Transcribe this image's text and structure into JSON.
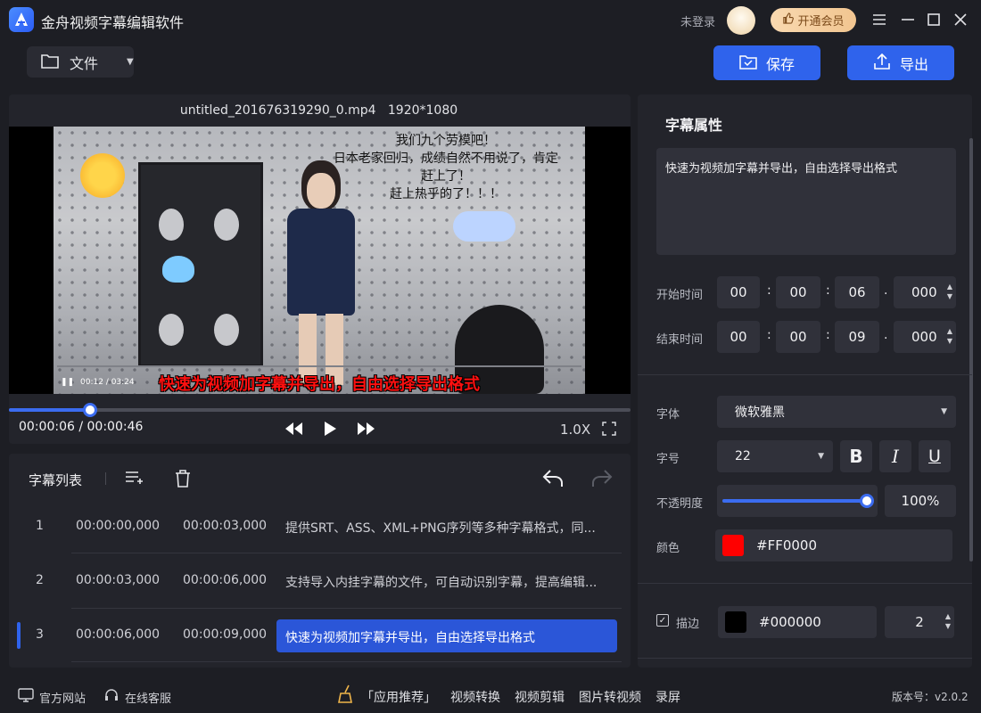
{
  "app": {
    "title": "金舟视频字幕编辑软件",
    "login_status": "未登录",
    "vip_button": "开通会员"
  },
  "toolbar": {
    "file_label": "文件",
    "save_label": "保存",
    "export_label": "导出"
  },
  "player": {
    "file_name": "untitled_201676319290_0.mp4",
    "resolution": "1920*1080",
    "subtitle_overlay": "快速为视频加字幕并导出，自由选择导出格式",
    "video_overlay_lines": [
      "我们九个劳模吧！",
      "日本老家回归，成绩自然不用说了，肯定",
      "赶上了！",
      "赶上热乎的了！！！"
    ],
    "inner_time": "00:12 / 03:24",
    "current_time": "00:00:06",
    "time_separator": "/",
    "total_time": "00:00:46",
    "progress": 0.13,
    "speed": "1.0X"
  },
  "subtitle_list": {
    "title": "字幕列表",
    "rows": [
      {
        "index": "1",
        "start": "00:00:00,000",
        "end": "00:00:03,000",
        "text": "提供SRT、ASS、XML+PNG序列等多种字幕格式，同..."
      },
      {
        "index": "2",
        "start": "00:00:03,000",
        "end": "00:00:06,000",
        "text": "支持导入内挂字幕的文件，可自动识别字幕，提高编辑..."
      },
      {
        "index": "3",
        "start": "00:00:06,000",
        "end": "00:00:09,000",
        "text": "快速为视频加字幕并导出，自由选择导出格式"
      }
    ]
  },
  "properties": {
    "title": "字幕属性",
    "text": "快速为视频加字幕并导出，自由选择导出格式",
    "start_label": "开始时间",
    "start": {
      "h": "00",
      "m": "00",
      "s": "06",
      "ms": "000"
    },
    "end_label": "结束时间",
    "end": {
      "h": "00",
      "m": "00",
      "s": "09",
      "ms": "000"
    },
    "time_colon": ":",
    "time_dot": ".",
    "font_label": "字体",
    "font_value": "微软雅黑",
    "size_label": "字号",
    "size_value": "22",
    "opacity_label": "不透明度",
    "opacity_value": "100%",
    "opacity_fraction": 1.0,
    "color_label": "颜色",
    "color_value": "#FF0000",
    "stroke_label": "描边",
    "stroke_checked": true,
    "stroke_color": "#000000",
    "stroke_width": "2",
    "bold_glyph": "B",
    "italic_glyph": "I",
    "underline_glyph": "U"
  },
  "footer": {
    "website": "官方网站",
    "support": "在线客服",
    "recommend": "「应用推荐」",
    "links": [
      "视频转换",
      "视频剪辑",
      "图片转视频",
      "录屏"
    ],
    "version": "版本号：v2.0.2"
  },
  "colors": {
    "accent": "#2f63ec",
    "background": "#1d1e24",
    "panel": "#23242b",
    "subtitle_red": "#ff0000",
    "stroke_black": "#000000"
  }
}
